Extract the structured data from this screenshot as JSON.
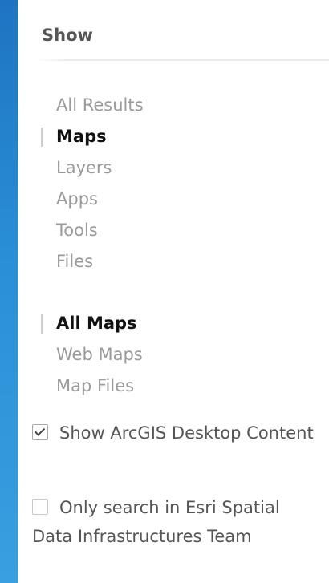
{
  "panel": {
    "title": "Show"
  },
  "content_types": {
    "items": [
      {
        "label": "All Results",
        "active": false
      },
      {
        "label": "Maps",
        "active": true
      },
      {
        "label": "Layers",
        "active": false
      },
      {
        "label": "Apps",
        "active": false
      },
      {
        "label": "Tools",
        "active": false
      },
      {
        "label": "Files",
        "active": false
      }
    ]
  },
  "map_types": {
    "items": [
      {
        "label": "All Maps",
        "active": true
      },
      {
        "label": "Web Maps",
        "active": false
      },
      {
        "label": "Map Files",
        "active": false
      }
    ]
  },
  "options": {
    "show_desktop": {
      "label": "Show ArcGIS Desktop Content",
      "checked": true
    },
    "esri_only": {
      "label": "Only search in Esri Spatial Data Infrastructures Team",
      "checked": false
    }
  }
}
